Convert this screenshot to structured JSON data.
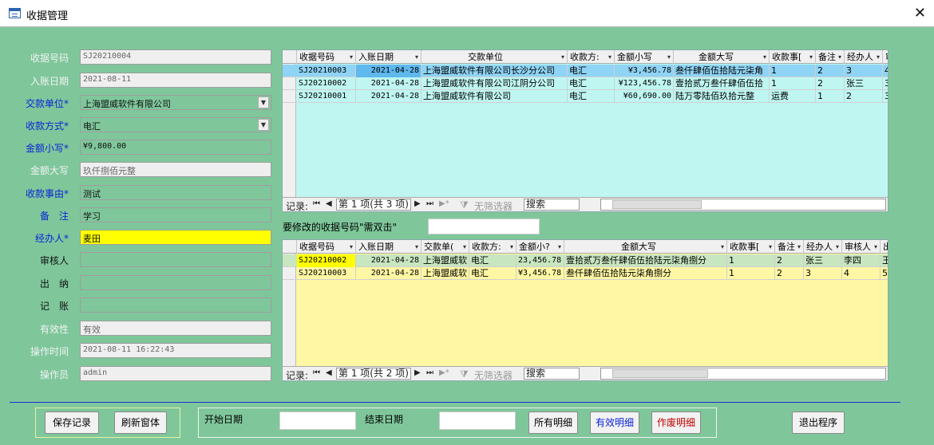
{
  "window": {
    "title": "收据管理",
    "close": "✕"
  },
  "form": {
    "receipt_no": {
      "label": "收据号码",
      "value": "SJ20210004"
    },
    "entry_date": {
      "label": "入账日期",
      "value": "2021-08-11"
    },
    "payer": {
      "label": "交款单位*",
      "value": "上海盟威软件有限公司"
    },
    "method": {
      "label": "收款方式*",
      "value": "电汇"
    },
    "amount": {
      "label": "金额小写*",
      "value": "¥9,800.00"
    },
    "amount_cn": {
      "label": "金额大写",
      "value": "玖仟捌佰元整"
    },
    "reason": {
      "label": "收款事由*",
      "value": "测试"
    },
    "note": {
      "label": "备　注",
      "value": "学习"
    },
    "handler": {
      "label": "经办人*",
      "value": "麦田"
    },
    "reviewer": {
      "label": "审核人",
      "value": ""
    },
    "cashier": {
      "label": "出　纳",
      "value": ""
    },
    "bookkeeper": {
      "label": "记　账",
      "value": ""
    },
    "validity": {
      "label": "有效性",
      "value": "有效"
    },
    "op_time": {
      "label": "操作时间",
      "value": "2021-08-11 16:22:43"
    },
    "operator": {
      "label": "操作员",
      "value": "admin"
    }
  },
  "grid1": {
    "headers": [
      "收据号码",
      "入账日期",
      "交款单位",
      "收款方:",
      "金额小写",
      "金额大写",
      "收款事[",
      "备注",
      "经办人",
      "审"
    ],
    "rows": [
      [
        "SJ20210003",
        "2021-04-28",
        "上海盟威软件有限公司长沙分公司",
        "电汇",
        "¥3,456.78",
        "叁仟肆佰伍拾陆元柒角",
        "1",
        "2",
        "3",
        "4"
      ],
      [
        "SJ20210002",
        "2021-04-28",
        "上海盟威软件有限公司江阴分公司",
        "电汇",
        "¥123,456.78",
        "壹拾贰万叁仟肆佰伍拾",
        "1",
        "2",
        "张三",
        "3"
      ],
      [
        "SJ20210001",
        "2021-04-28",
        "上海盟威软件有限公司",
        "电汇",
        "¥60,690.00",
        "陆万零陆佰玖拾元整",
        "运费",
        "1",
        "2",
        "3"
      ]
    ],
    "nav": {
      "record": "记录:",
      "position": "第 1 项(共 3 项)",
      "filter": "无筛选器",
      "search": "搜索"
    }
  },
  "hint": {
    "label": "要修改的收据号码\"需双击\"",
    "value": ""
  },
  "grid2": {
    "headers": [
      "收据号码",
      "入账日期",
      "交款单(",
      "收款方:",
      "金额小?",
      "金额大写",
      "收款事[",
      "备注",
      "经办人",
      "审核人",
      "出"
    ],
    "rows": [
      [
        "SJ20210002",
        "2021-04-28",
        "上海盟威软",
        "电汇",
        "23,456.78",
        "壹拾贰万叁仟肆佰伍拾陆元柒角捌分",
        "1",
        "2",
        "张三",
        "李四",
        "王"
      ],
      [
        "SJ20210003",
        "2021-04-28",
        "上海盟威软",
        "电汇",
        "¥3,456.78",
        "叁仟肆佰伍拾陆元柒角捌分",
        "1",
        "2",
        "3",
        "4",
        "5"
      ]
    ],
    "nav": {
      "record": "记录:",
      "position": "第 1 项(共 2 项)",
      "filter": "无筛选器",
      "search": "搜索"
    }
  },
  "footer": {
    "save": "保存记录",
    "refresh": "刷新窗体",
    "start_date": "开始日期",
    "end_date": "结束日期",
    "all": "所有明细",
    "valid": "有效明细",
    "void": "作废明细",
    "exit": "退出程序"
  },
  "colors": {
    "bg": "#7fc79b",
    "grid1_bg": "#bff6f1",
    "grid2_bg": "#fff7a3",
    "link_blue": "#0b24d6",
    "void_red": "#c00000"
  }
}
